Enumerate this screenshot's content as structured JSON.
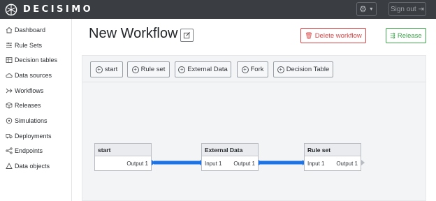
{
  "app": {
    "brand": "DECISIMO",
    "sign_out_label": "Sign out"
  },
  "sidebar": {
    "items": [
      {
        "label": "Dashboard",
        "icon": "home-icon"
      },
      {
        "label": "Rule Sets",
        "icon": "ruleset-icon"
      },
      {
        "label": "Decision tables",
        "icon": "table-icon"
      },
      {
        "label": "Data sources",
        "icon": "cloud-icon"
      },
      {
        "label": "Workflows",
        "icon": "workflow-icon"
      },
      {
        "label": "Releases",
        "icon": "box-icon"
      },
      {
        "label": "Simulations",
        "icon": "simulation-icon"
      },
      {
        "label": "Deployments",
        "icon": "truck-icon"
      },
      {
        "label": "Endpoints",
        "icon": "share-icon"
      },
      {
        "label": "Data objects",
        "icon": "triangle-icon"
      }
    ]
  },
  "page": {
    "title": "New Workflow",
    "delete_label": "Delete workflow",
    "release_label": "Release"
  },
  "toolbar": {
    "buttons": [
      "start",
      "Rule set",
      "External Data",
      "Fork",
      "Decision Table"
    ]
  },
  "workflow": {
    "nodes": [
      {
        "title": "start",
        "input": "",
        "output": "Output 1"
      },
      {
        "title": "External Data",
        "input": "Input 1",
        "output": "Output 1"
      },
      {
        "title": "Rule set",
        "input": "Input 1",
        "output": "Output 1"
      }
    ]
  },
  "colors": {
    "topbar": "#3a3d42",
    "danger": "#d64545",
    "success": "#3fa34d",
    "wire": "#1a73e8"
  }
}
